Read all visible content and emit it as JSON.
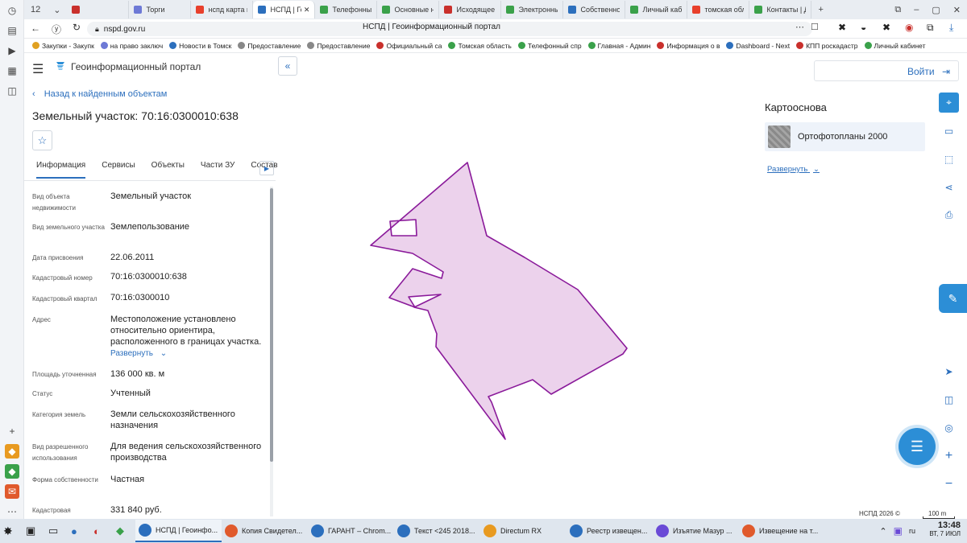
{
  "browser": {
    "tab_counter": "12",
    "tabs": [
      {
        "title": "",
        "color": "#c9302c"
      },
      {
        "title": "Торги",
        "color": "#6d79d6"
      },
      {
        "title": "нспд карта п",
        "color": "#e8402c"
      },
      {
        "title": "НСПД | Ге",
        "color": "#2c6fbd",
        "active": true
      },
      {
        "title": "Телефонный",
        "color": "#3aa14a"
      },
      {
        "title": "Основные на",
        "color": "#3aa14a"
      },
      {
        "title": "Исходящее п",
        "color": "#c9302c"
      },
      {
        "title": "Электронны",
        "color": "#3aa14a"
      },
      {
        "title": "Собственно",
        "color": "#2c6fbd"
      },
      {
        "title": "Личный каб",
        "color": "#3aa14a"
      },
      {
        "title": "томская обл",
        "color": "#e8402c"
      },
      {
        "title": "Контакты | Д",
        "color": "#3aa14a"
      }
    ],
    "url": "nspd.gov.ru",
    "page_title": "НСПД | Геоинформационный портал",
    "bookmarks": [
      {
        "label": "Закупки - Закупк",
        "color": "#e0a020"
      },
      {
        "label": "на право заключ",
        "color": "#6d79d6"
      },
      {
        "label": "Новости в Томск",
        "color": "#2c6fbd"
      },
      {
        "label": "Предоставление",
        "color": "#888888"
      },
      {
        "label": "Предоставление",
        "color": "#888888"
      },
      {
        "label": "Официальный са",
        "color": "#c9302c"
      },
      {
        "label": "Томская область",
        "color": "#3aa14a"
      },
      {
        "label": "Телефонный спр",
        "color": "#3aa14a"
      },
      {
        "label": "Главная - Админ",
        "color": "#3aa14a"
      },
      {
        "label": "Информация о в",
        "color": "#c9302c"
      },
      {
        "label": "Dashboard - Next",
        "color": "#2c6fbd"
      },
      {
        "label": "КПП роскадастр",
        "color": "#c9302c"
      },
      {
        "label": "Личный кабинет",
        "color": "#3aa14a"
      }
    ]
  },
  "portal": {
    "name": "Геоинформационный портал",
    "back_link": "Назад к найденным объектам",
    "object_title": "Земельный участок: 70:16:0300010:638",
    "tabs": [
      "Информация",
      "Сервисы",
      "Объекты",
      "Части ЗУ",
      "Состав"
    ],
    "properties": [
      {
        "label": "Вид объекта недвижимости",
        "value": "Земельный участок"
      },
      {
        "label": "Вид земельного участка",
        "value": "Землепользование"
      },
      {
        "label": "Дата присвоения",
        "value": "22.06.2011"
      },
      {
        "label": "Кадастровый номер",
        "value": "70:16:0300010:638"
      },
      {
        "label": "Кадастровый квартал",
        "value": "70:16:0300010"
      },
      {
        "label": "Адрес",
        "value": "Местоположение установлено относительно ориентира, расположенного в границах участка."
      },
      {
        "label": "Площадь уточненная",
        "value": "136 000 кв. м"
      },
      {
        "label": "Статус",
        "value": "Учтенный"
      },
      {
        "label": "Категория земель",
        "value": "Земли сельскохозяйственного назначения"
      },
      {
        "label": "Вид разрешенного использования",
        "value": "Для ведения сельскохозяйственного производства"
      },
      {
        "label": "Форма собственности",
        "value": "Частная"
      },
      {
        "label": "Кадастровая",
        "value": "331 840 руб."
      }
    ],
    "expand_label": "Развернуть",
    "login_label": "Войти",
    "basemap_title": "Картооснова",
    "basemap_name": "Ортофотопланы 2000",
    "basemap_expand": "Развернуть",
    "copyright": "НСПД 2026 ©",
    "scale": "100 m",
    "parcel_fill": "#ecd2ec",
    "parcel_stroke": "#8a1a9a"
  },
  "taskbar": {
    "apps": [
      {
        "label": "НСПД | Геоинфо...",
        "color": "#2c6fbd",
        "active": true
      },
      {
        "label": "Копия Свидетел...",
        "color": "#e05a2c"
      },
      {
        "label": "ГАРАНТ – Chrom...",
        "color": "#2c6fbd"
      },
      {
        "label": "Текст <245 2018...",
        "color": "#2c6fbd"
      },
      {
        "label": "Directum RX",
        "color": "#e89a20"
      },
      {
        "label": "Реестр извещен...",
        "color": "#2c6fbd"
      },
      {
        "label": "Изъятие Мазур ...",
        "color": "#6a4ad6"
      },
      {
        "label": "Извещение на т...",
        "color": "#e05a2c"
      }
    ],
    "lang": "ru",
    "time": "13:48",
    "date": "ВТ, 7 ИЮЛ"
  }
}
